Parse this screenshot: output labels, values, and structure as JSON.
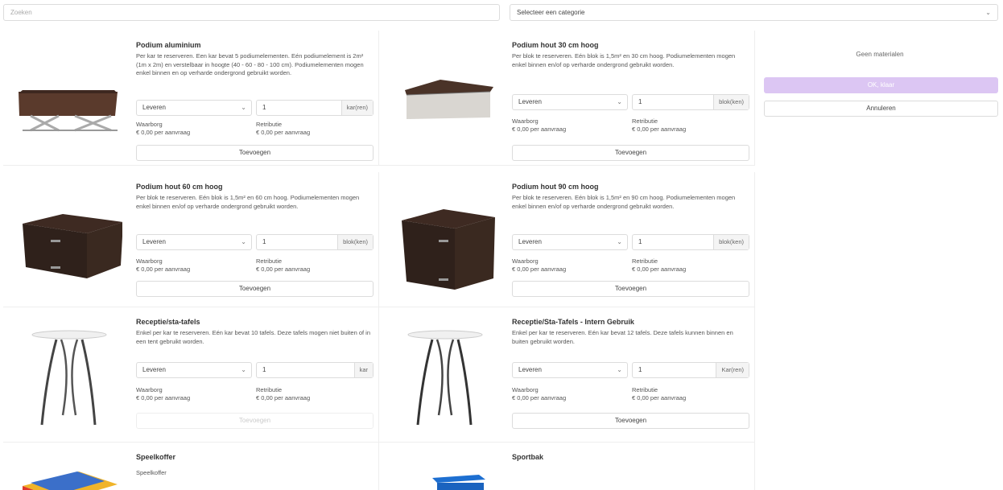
{
  "search": {
    "placeholder": "Zoeken"
  },
  "category": {
    "selected": "Selecteer een categorie"
  },
  "products": [
    {
      "title": "Podium aluminium",
      "description": "Per kar te reserveren. Een kar bevat 5 podiumelementen. Eén podiumelement is 2m² (1m x 2m) en verstelbaar in hoogte (40 - 60 - 80 - 100 cm). Podiumelementen mogen enkel binnen en op verharde ondergrond gebruikt worden.",
      "delivery": "Leveren",
      "quantity": "1",
      "unit": "kar(ren)",
      "deposit_label": "Waarborg",
      "deposit_value": "€ 0,00 per aanvraag",
      "fee_label": "Retributie",
      "fee_value": "€ 0,00 per aanvraag",
      "add_label": "Toevoegen",
      "icon": "aluminium-stage-image"
    },
    {
      "title": "Podium hout 30 cm hoog",
      "description": "Per blok te reserveren. Eén blok is 1,5m² en 30 cm hoog. Podiumelementen mogen enkel binnen en/of op verharde ondergrond gebruikt worden.",
      "delivery": "Leveren",
      "quantity": "1",
      "unit": "blok(ken)",
      "deposit_label": "Waarborg",
      "deposit_value": "€ 0,00 per aanvraag",
      "fee_label": "Retributie",
      "fee_value": "€ 0,00 per aanvraag",
      "add_label": "Toevoegen",
      "icon": "wood-stage-30-image"
    },
    {
      "title": "Podium hout 60 cm hoog",
      "description": "Per blok te reserveren. Eén blok is 1,5m² en 60 cm hoog. Podiumelementen mogen enkel binnen en/of op verharde ondergrond gebruikt worden.",
      "delivery": "Leveren",
      "quantity": "1",
      "unit": "blok(ken)",
      "deposit_label": "Waarborg",
      "deposit_value": "€ 0,00 per aanvraag",
      "fee_label": "Retributie",
      "fee_value": "€ 0,00 per aanvraag",
      "add_label": "Toevoegen",
      "icon": "wood-stage-60-image"
    },
    {
      "title": "Podium hout 90 cm hoog",
      "description": "Per blok te reserveren. Eén blok is 1,5m² en 90 cm hoog. Podiumelementen mogen enkel binnen en/of op verharde ondergrond gebruikt worden.",
      "delivery": "Leveren",
      "quantity": "1",
      "unit": "blok(ken)",
      "deposit_label": "Waarborg",
      "deposit_value": "€ 0,00 per aanvraag",
      "fee_label": "Retributie",
      "fee_value": "€ 0,00 per aanvraag",
      "add_label": "Toevoegen",
      "icon": "wood-stage-90-image"
    },
    {
      "title": "Receptie/sta-tafels",
      "description": "Enkel per kar te reserveren. Eén kar bevat 10 tafels. Deze tafels mogen niet buiten of in een tent gebruikt worden.",
      "delivery": "Leveren",
      "quantity": "1",
      "unit": "kar",
      "deposit_label": "Waarborg",
      "deposit_value": "€ 0,00 per aanvraag",
      "fee_label": "Retributie",
      "fee_value": "€ 0,00 per aanvraag",
      "add_label": "Toevoegen",
      "add_disabled": true,
      "icon": "standing-table-image"
    },
    {
      "title": "Receptie/Sta-Tafels - Intern Gebruik",
      "description": "Enkel per kar te reserveren. Eén kar bevat 12 tafels. Deze tafels kunnen binnen en buiten gebruikt worden.",
      "delivery": "Leveren",
      "quantity": "1",
      "unit": "Kar(ren)",
      "deposit_label": "Waarborg",
      "deposit_value": "€ 0,00 per aanvraag",
      "fee_label": "Retributie",
      "fee_value": "€ 0,00 per aanvraag",
      "add_label": "Toevoegen",
      "icon": "standing-table-image"
    },
    {
      "title": "Speelkoffer",
      "description": "Speelkoffer",
      "icon": "play-case-image"
    },
    {
      "title": "Sportbak",
      "description": "",
      "icon": "sport-bin-image"
    }
  ],
  "sidebar": {
    "empty_text": "Geen materialen",
    "ok_label": "OK, klaar",
    "cancel_label": "Annuleren"
  },
  "colors": {
    "accent_disabled": "#dcc6f3",
    "border": "#dcdcdc"
  }
}
